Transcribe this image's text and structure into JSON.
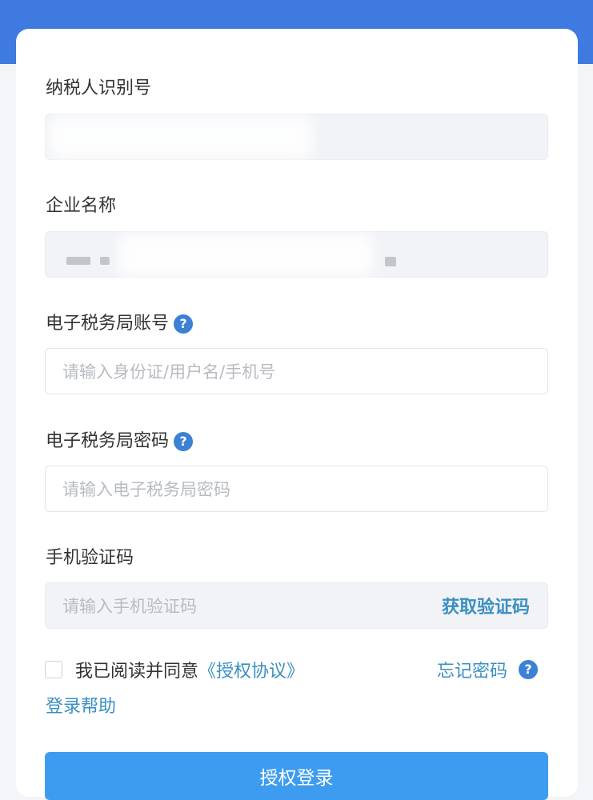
{
  "colors": {
    "header_blue": "#3e7ae0",
    "link_blue": "#3b8fc2",
    "button_blue": "#3d9cf0",
    "help_icon_blue": "#3b82d6"
  },
  "form": {
    "taxpayer_id": {
      "label": "纳税人识别号",
      "value": ""
    },
    "company_name": {
      "label": "企业名称",
      "value": ""
    },
    "etax_account": {
      "label": "电子税务局账号",
      "help_icon": "question-circle-icon",
      "placeholder": "请输入身份证/用户名/手机号"
    },
    "etax_password": {
      "label": "电子税务局密码",
      "help_icon": "question-circle-icon",
      "placeholder": "请输入电子税务局密码"
    },
    "sms_code": {
      "label": "手机验证码",
      "placeholder": "请输入手机验证码",
      "action_label": "获取验证码"
    },
    "agreement": {
      "checked": false,
      "text": "我已阅读并同意",
      "link_label": "《授权协议》"
    },
    "forgot_password": {
      "label": "忘记密码",
      "help_icon": "question-circle-icon"
    },
    "login_help_label": "登录帮助",
    "submit_label": "授权登录"
  }
}
